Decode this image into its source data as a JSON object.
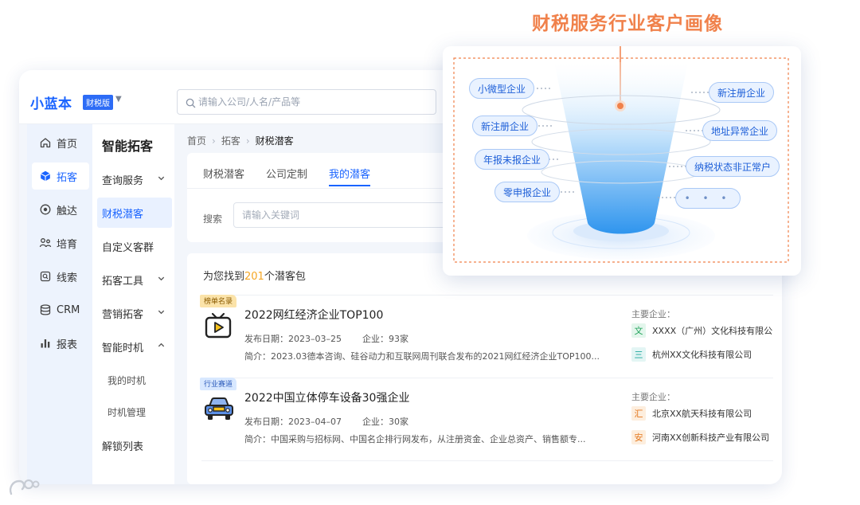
{
  "app": {
    "logo": "小蓝本",
    "edition": "财税版",
    "search_placeholder": "请输入公司/人名/产品等"
  },
  "left_nav": [
    {
      "label": "首页",
      "icon": "home-icon"
    },
    {
      "label": "拓客",
      "icon": "cube-icon",
      "active": true
    },
    {
      "label": "触达",
      "icon": "target-icon"
    },
    {
      "label": "培育",
      "icon": "people-icon"
    },
    {
      "label": "线索",
      "icon": "clue-icon"
    },
    {
      "label": "CRM",
      "icon": "database-icon"
    },
    {
      "label": "报表",
      "icon": "bar-chart-icon"
    }
  ],
  "sub_nav": {
    "title": "智能拓客",
    "items": [
      {
        "label": "查询服务",
        "expandable": true
      },
      {
        "label": "财税潜客",
        "active": true
      },
      {
        "label": "自定义客群"
      },
      {
        "label": "拓客工具",
        "expandable": true
      },
      {
        "label": "营销拓客",
        "expandable": true
      },
      {
        "label": "智能时机",
        "expanded": true
      },
      {
        "label": "我的时机",
        "child": true
      },
      {
        "label": "时机管理",
        "child": true
      },
      {
        "label": "解锁列表"
      }
    ]
  },
  "breadcrumb": [
    "首页",
    "拓客",
    "财税潜客"
  ],
  "tabs": [
    {
      "label": "财税潜客"
    },
    {
      "label": "公司定制"
    },
    {
      "label": "我的潜客",
      "active": true
    }
  ],
  "filter": {
    "label": "搜索",
    "placeholder": "请输入关键词"
  },
  "results": {
    "prefix": "为您找到",
    "count": "201",
    "suffix": "个潜客包",
    "packages": [
      {
        "tag": "榜单名录",
        "icon": "tv-play-icon",
        "title": "2022网红经济企业TOP100",
        "date_label": "发布日期：",
        "date": "2023–03–25",
        "count_label": "企业：",
        "count": "93家",
        "intro_label": "简介：",
        "intro": "2023.03德本咨询、硅谷动力和互联网周刊联合发布的2021网红经济企业TOP100...",
        "main_label": "主要企业：",
        "companies": [
          {
            "badge": "文",
            "name": "XXXX（广州）文化科技有限公",
            "color": "green"
          },
          {
            "badge": "三",
            "name": "杭州XX文化科技有限公司",
            "color": "teal"
          }
        ]
      },
      {
        "tag": "行业赛道",
        "icon": "car-icon",
        "title": "2022中国立体停车设备30强企业",
        "date_label": "发布日期：",
        "date": "2023–04–07",
        "count_label": "企业：",
        "count": "30家",
        "intro_label": "简介：",
        "intro": "中国采购与招标网、中国名企排行网发布，从注册资金、企业总资产、销售额专...",
        "main_label": "主要企业：",
        "companies": [
          {
            "badge": "汇",
            "name": "北京XX航天科技有限公司",
            "color": "orange"
          },
          {
            "badge": "安",
            "name": "河南XX创新科技产业有限公司",
            "color": "orange"
          }
        ]
      }
    ]
  },
  "funnel": {
    "title": "财税服务行业客户画像",
    "left_pills": [
      "小微型企业",
      "新注册企业",
      "年报未报企业",
      "零申报企业"
    ],
    "right_pills": [
      "新注册企业",
      "地址异常企业",
      "纳税状态非正常户",
      "• • •"
    ]
  },
  "colors": {
    "brand": "#1a64ff",
    "accent": "#f0814b",
    "highlight": "#f5a623"
  }
}
